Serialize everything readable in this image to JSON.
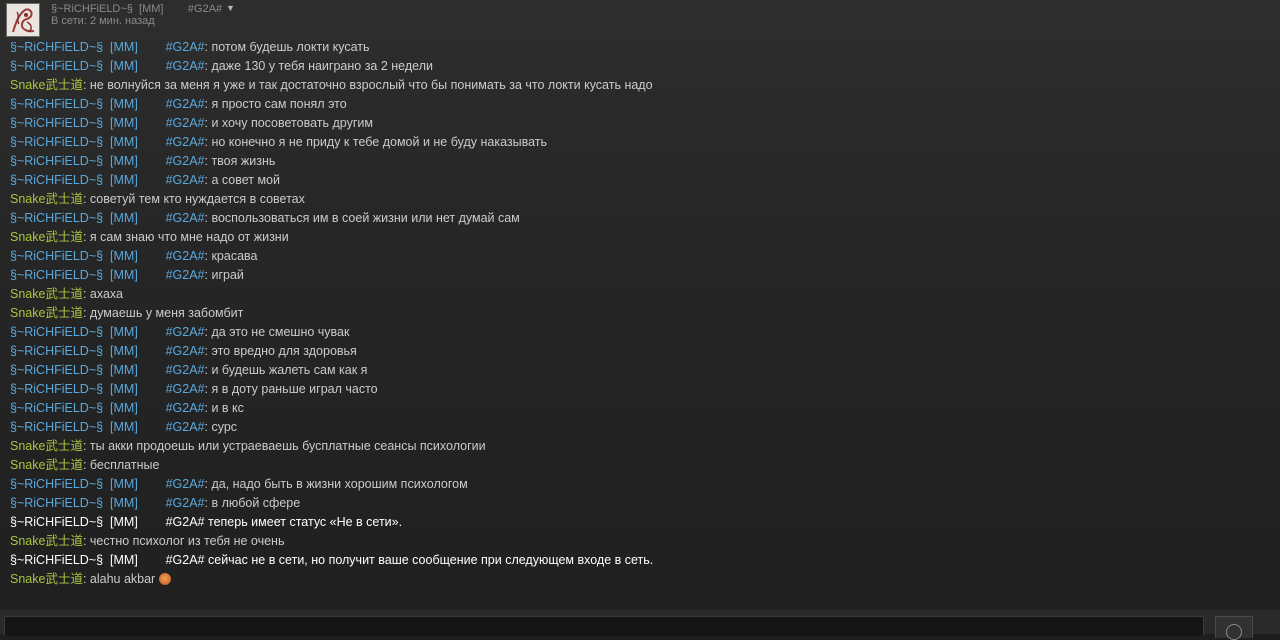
{
  "header": {
    "name": "§~RiCHFiELD~§  [MM]        #G2A#",
    "status": "В сети: 2 мин. назад",
    "dropdown_icon": "chevron-down-icon"
  },
  "messages": [
    {
      "type": "user",
      "sender": "§~RiCHFiELD~§  [MM]        #G2A#",
      "text": ": потом будешь локти кусать"
    },
    {
      "type": "user",
      "sender": "§~RiCHFiELD~§  [MM]        #G2A#",
      "text": ": даже 130 у тебя наиграно за 2 недели"
    },
    {
      "type": "snake",
      "sender": "Snake武士道",
      "text": ": не волнуйся за меня я уже и так достаточно взрослый что бы понимать за что локти кусать надо"
    },
    {
      "type": "user",
      "sender": "§~RiCHFiELD~§  [MM]        #G2A#",
      "text": ": я просто сам понял это"
    },
    {
      "type": "user",
      "sender": "§~RiCHFiELD~§  [MM]        #G2A#",
      "text": ": и хочу посоветовать другим"
    },
    {
      "type": "user",
      "sender": "§~RiCHFiELD~§  [MM]        #G2A#",
      "text": ": но конечно я не приду к тебе домой и не буду наказывать"
    },
    {
      "type": "user",
      "sender": "§~RiCHFiELD~§  [MM]        #G2A#",
      "text": ": твоя жизнь"
    },
    {
      "type": "user",
      "sender": "§~RiCHFiELD~§  [MM]        #G2A#",
      "text": ": а совет мой"
    },
    {
      "type": "snake",
      "sender": "Snake武士道",
      "text": ": советуй тем кто нуждается в советах"
    },
    {
      "type": "user",
      "sender": "§~RiCHFiELD~§  [MM]        #G2A#",
      "text": ": воспользоваться им в соей жизни или нет думай сам"
    },
    {
      "type": "snake",
      "sender": "Snake武士道",
      "text": ": я сам знаю что мне надо от жизни"
    },
    {
      "type": "user",
      "sender": "§~RiCHFiELD~§  [MM]        #G2A#",
      "text": ": красава"
    },
    {
      "type": "user",
      "sender": "§~RiCHFiELD~§  [MM]        #G2A#",
      "text": ": играй"
    },
    {
      "type": "snake",
      "sender": "Snake武士道",
      "text": ": ахаха"
    },
    {
      "type": "snake",
      "sender": "Snake武士道",
      "text": ": думаешь у меня забомбит"
    },
    {
      "type": "user",
      "sender": "§~RiCHFiELD~§  [MM]        #G2A#",
      "text": ": да это не смешно чувак"
    },
    {
      "type": "user",
      "sender": "§~RiCHFiELD~§  [MM]        #G2A#",
      "text": ": это вредно для здоровья"
    },
    {
      "type": "user",
      "sender": "§~RiCHFiELD~§  [MM]        #G2A#",
      "text": ": и будешь жалеть сам как я"
    },
    {
      "type": "user",
      "sender": "§~RiCHFiELD~§  [MM]        #G2A#",
      "text": ": я в доту раньше играл часто"
    },
    {
      "type": "user",
      "sender": "§~RiCHFiELD~§  [MM]        #G2A#",
      "text": ": и в кс"
    },
    {
      "type": "user",
      "sender": "§~RiCHFiELD~§  [MM]        #G2A#",
      "text": ": сурс"
    },
    {
      "type": "snake",
      "sender": "Snake武士道",
      "text": ": ты акки продоешь или устраеваешь бусплатные сеансы психологии"
    },
    {
      "type": "snake",
      "sender": "Snake武士道",
      "text": ": бесплатные"
    },
    {
      "type": "user",
      "sender": "§~RiCHFiELD~§  [MM]        #G2A#",
      "text": ": да, надо быть в жизни хорошим психологом"
    },
    {
      "type": "user",
      "sender": "§~RiCHFiELD~§  [MM]        #G2A#",
      "text": ": в любой сфере"
    },
    {
      "type": "system",
      "sender": "§~RiCHFiELD~§  [MM]        #G2A#",
      "text": " теперь имеет статус «Не в сети»."
    },
    {
      "type": "snake",
      "sender": "Snake武士道",
      "text": ": честно психолог из тебя не очень"
    },
    {
      "type": "system",
      "sender": "§~RiCHFiELD~§  [MM]        #G2A#",
      "text": " сейчас не в сети, но получит ваше сообщение при следующем входе в сеть."
    },
    {
      "type": "snake",
      "sender": "Snake武士道",
      "text": ": alahu akbar",
      "emoji": "laughing-emoticon"
    }
  ],
  "composer": {
    "input_value": "",
    "emoji_button_icon": "emoticon-icon"
  }
}
